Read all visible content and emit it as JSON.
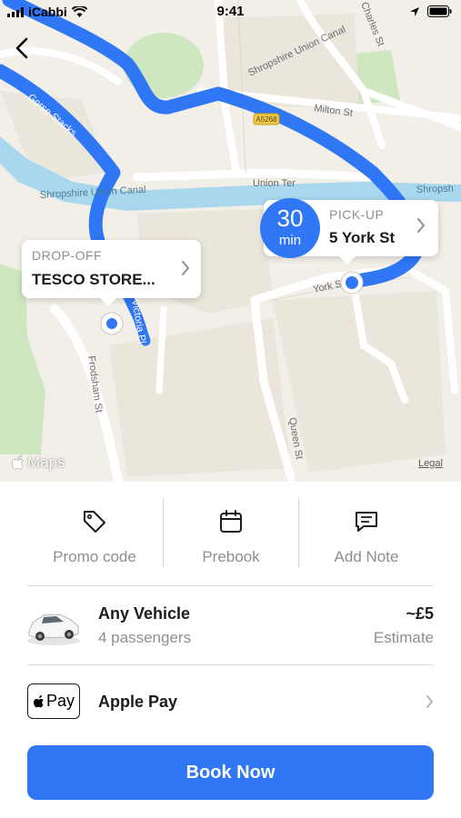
{
  "status_bar": {
    "carrier": "iCabbi",
    "time": "9:41",
    "icons": [
      "signal-icon",
      "wifi-icon",
      "location-arrow-icon",
      "battery-icon"
    ]
  },
  "map": {
    "street_labels": [
      "Charles St",
      "Milton St",
      "A5268",
      "Union Ter",
      "Shropshire Union Canal",
      "Shropsh",
      "Gorse Stacks",
      "York St",
      "Victoria Pl",
      "Frodsham St",
      "Queen St"
    ],
    "maps_label": "Maps",
    "legal": "Legal",
    "colors": {
      "route": "#2f77f5",
      "water": "#a9d7ee",
      "park": "#cfe7c1",
      "land": "#f2efe8",
      "road": "#ffffff"
    }
  },
  "drop_off": {
    "title": "DROP-OFF",
    "value": "TESCO STORE..."
  },
  "pick_up": {
    "title": "PICK-UP",
    "value": "5 York St"
  },
  "eta": {
    "number": "30",
    "unit": "min"
  },
  "options": [
    {
      "label": "Promo code",
      "icon": "tag-icon"
    },
    {
      "label": "Prebook",
      "icon": "calendar-icon"
    },
    {
      "label": "Add Note",
      "icon": "note-icon"
    }
  ],
  "vehicle": {
    "name": "Any Vehicle",
    "passengers": "4 passengers",
    "price": "~£5",
    "price_note": "Estimate",
    "icon": "car-icon"
  },
  "payment": {
    "badge_text": "Pay",
    "name": "Apple Pay"
  },
  "book_button": "Book Now",
  "accent_color": "#2f77f5"
}
